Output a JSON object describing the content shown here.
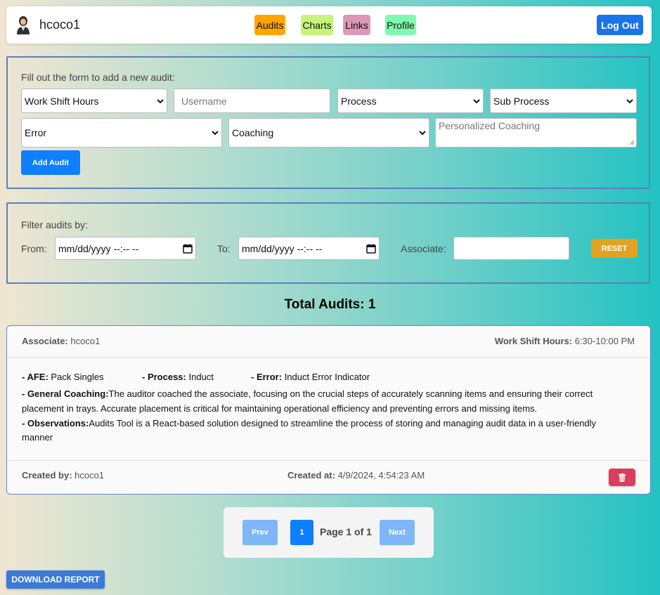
{
  "header": {
    "username": "hcoco1",
    "nav": [
      {
        "label": "Audits",
        "color": "#ffa500"
      },
      {
        "label": "Charts",
        "color": "#c6f579"
      },
      {
        "label": "Links",
        "color": "#dc98b4"
      },
      {
        "label": "Profile",
        "color": "#7ffaae"
      }
    ],
    "logout_label": "Log Out"
  },
  "add_form": {
    "title": "Fill out the form to add a new audit:",
    "work_shift_hours": "Work Shift Hours",
    "username_placeholder": "Username",
    "process": "Process",
    "sub_process": "Sub Process",
    "error": "Error",
    "coaching": "Coaching",
    "personalized_coaching_placeholder": "Personalized Coaching",
    "add_button": "Add Audit"
  },
  "filter": {
    "title": "Filter audits by:",
    "from_label": "From:",
    "from_value": "mm/dd/yyyy --:-- --",
    "to_label": "To:",
    "to_value": "mm/dd/yyyy --:-- --",
    "associate_label": "Associate:",
    "associate_value": "",
    "reset_label": "RESET"
  },
  "total": "Total Audits: 1",
  "audit": {
    "associate_label": "Associate:",
    "associate": "hcoco1",
    "shift_label": "Work Shift Hours:",
    "shift": "6:30-10:00 PM",
    "afe_label": "- AFE:",
    "afe": "Pack Singles",
    "process_label": "- Process:",
    "process": "Induct",
    "error_label": "- Error:",
    "error": "Induct Error Indicator",
    "coaching_label": "- General Coaching:",
    "coaching_line1": "The auditor coached the associate, focusing on the crucial steps of accurately scanning items and ensuring their correct",
    "coaching_line2": "placement in trays. Accurate placement is critical for maintaining operational efficiency and preventing errors and missing items.",
    "observations_label": "- Observations:",
    "observations_line1": "Audits Tool is a React-based solution designed to streamline the process of storing and managing audit data in a user-friendly",
    "observations_line2": "manner",
    "created_by_label": "Created by:",
    "created_by": "hcoco1",
    "created_at_label": "Created at:",
    "created_at": "4/9/2024, 4:54:23 AM"
  },
  "pagination": {
    "prev": "Prev",
    "current": "1",
    "info": "Page 1 of 1",
    "next": "Next"
  },
  "download_label": "DOWNLOAD REPORT"
}
